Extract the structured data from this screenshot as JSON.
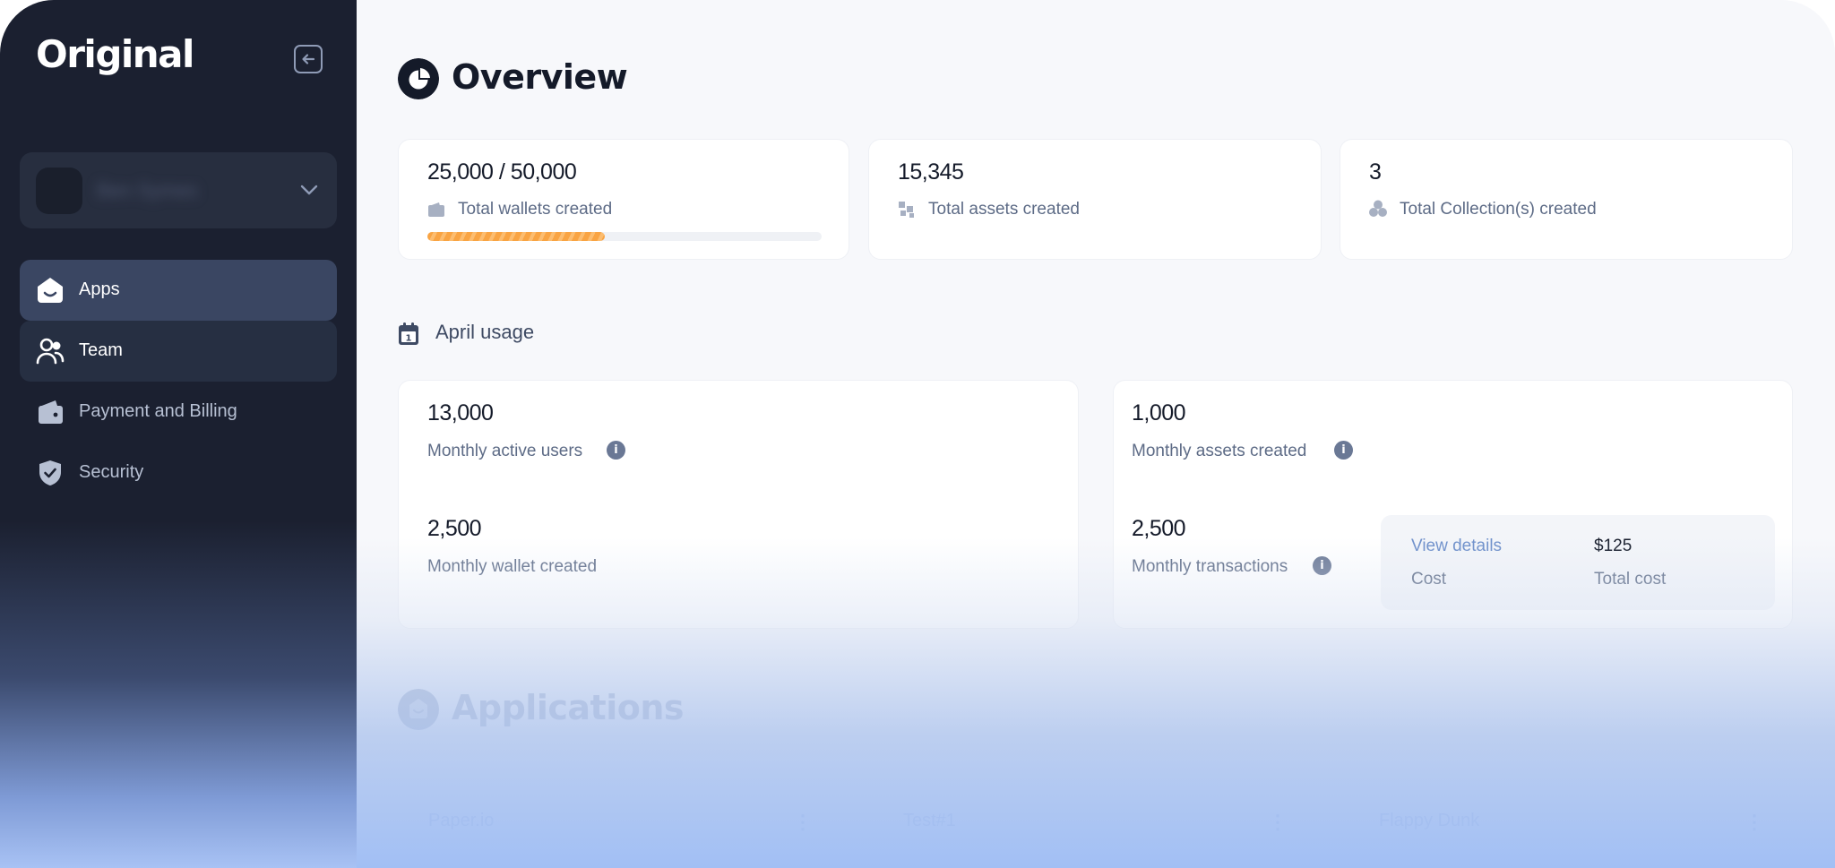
{
  "brand": {
    "logo": "Original"
  },
  "sidebar": {
    "workspace_name": "Ben Symes",
    "items": [
      {
        "label": "Apps",
        "icon": "apps-icon"
      },
      {
        "label": "Team",
        "icon": "team-icon"
      },
      {
        "label": "Payment and Billing",
        "icon": "wallet-icon"
      },
      {
        "label": "Security",
        "icon": "shield-icon"
      }
    ]
  },
  "overview": {
    "title": "Overview",
    "stats": [
      {
        "value": "25,000 / 50,000",
        "label": "Total wallets created",
        "progress": 0.45
      },
      {
        "value": "15,345",
        "label": "Total assets created"
      },
      {
        "value": "3",
        "label": "Total Collection(s) created"
      }
    ]
  },
  "usage": {
    "heading": "April usage",
    "calendar_day": "1",
    "left": [
      {
        "value": "13,000",
        "label": "Monthly active users"
      },
      {
        "value": "2,500",
        "label": "Monthly wallet created"
      }
    ],
    "right": [
      {
        "value": "1,000",
        "label": "Monthly assets created"
      },
      {
        "value": "2,500",
        "label": "Monthly transactions"
      }
    ],
    "cost": {
      "view_details": "View details",
      "cost_label": "Cost",
      "price": "$125",
      "total_label": "Total cost"
    }
  },
  "applications": {
    "title": "Applications",
    "apps": [
      "Paper.io",
      "Test#1",
      "Flappy Dunk"
    ]
  },
  "colors": {
    "sidebar_bg": "#1b2030",
    "active_nav": "#3a4662",
    "progress": "#f9a443",
    "link": "#6d8fca"
  }
}
